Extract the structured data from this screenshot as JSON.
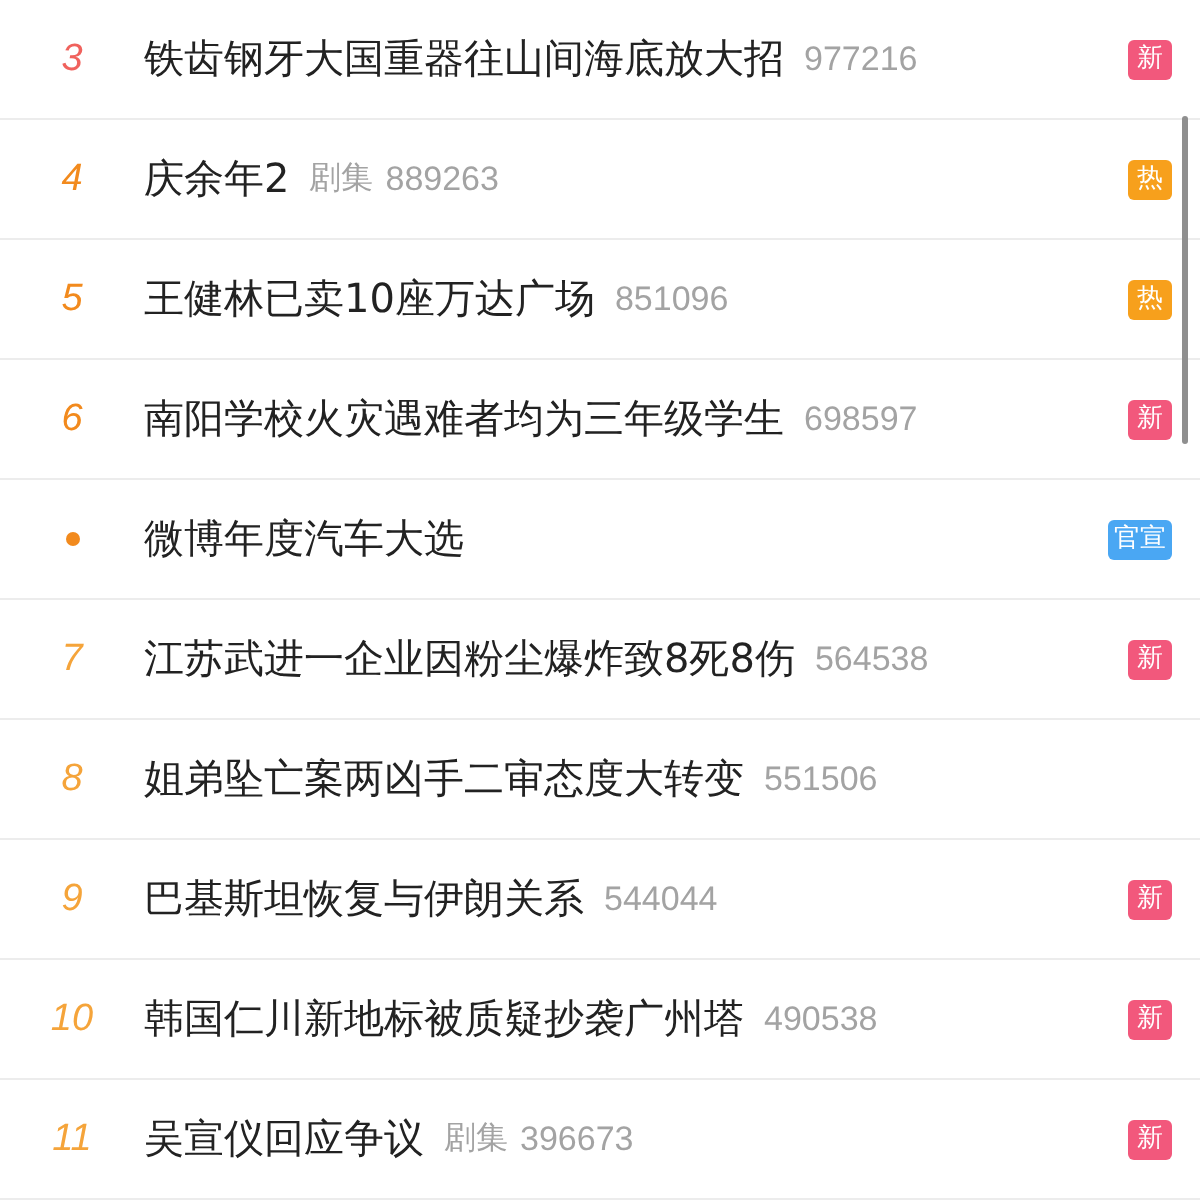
{
  "rows": [
    {
      "rank": "3",
      "color": "#f0625d",
      "kind": "number",
      "title": "铁齿钢牙大国重器往山间海底放大招",
      "count": "977216",
      "badge": {
        "text": "新",
        "color": "#f2587c"
      }
    },
    {
      "rank": "4",
      "color": "#f28a1d",
      "kind": "number",
      "title": "庆余年2",
      "category": "剧集",
      "count": "889263",
      "badge": {
        "text": "热",
        "color": "#f7a01c"
      }
    },
    {
      "rank": "5",
      "color": "#f28a1d",
      "kind": "number",
      "title": "王健林已卖10座万达广场",
      "count": "851096",
      "badge": {
        "text": "热",
        "color": "#f7a01c"
      }
    },
    {
      "rank": "6",
      "color": "#f28a1d",
      "kind": "number",
      "title": "南阳学校火灾遇难者均为三年级学生",
      "count": "698597",
      "badge": {
        "text": "新",
        "color": "#f2587c"
      }
    },
    {
      "color": "#f28a1d",
      "kind": "dot",
      "title": "微博年度汽车大选",
      "badge": {
        "text": "官宣",
        "color": "#4aa7f3"
      }
    },
    {
      "rank": "7",
      "color": "#f5a43a",
      "kind": "number",
      "title": "江苏武进一企业因粉尘爆炸致8死8伤",
      "count": "564538",
      "badge": {
        "text": "新",
        "color": "#f2587c"
      }
    },
    {
      "rank": "8",
      "color": "#f5a43a",
      "kind": "number",
      "title": "姐弟坠亡案两凶手二审态度大转变",
      "count": "551506"
    },
    {
      "rank": "9",
      "color": "#f5a43a",
      "kind": "number",
      "title": "巴基斯坦恢复与伊朗关系",
      "count": "544044",
      "badge": {
        "text": "新",
        "color": "#f2587c"
      }
    },
    {
      "rank": "10",
      "color": "#f5a43a",
      "kind": "number",
      "title": "韩国仁川新地标被质疑抄袭广州塔",
      "count": "490538",
      "badge": {
        "text": "新",
        "color": "#f2587c"
      }
    },
    {
      "rank": "11",
      "color": "#f5a43a",
      "kind": "number",
      "title": "吴宣仪回应争议",
      "category": "剧集",
      "count": "396673",
      "badge": {
        "text": "新",
        "color": "#f2587c"
      }
    }
  ]
}
